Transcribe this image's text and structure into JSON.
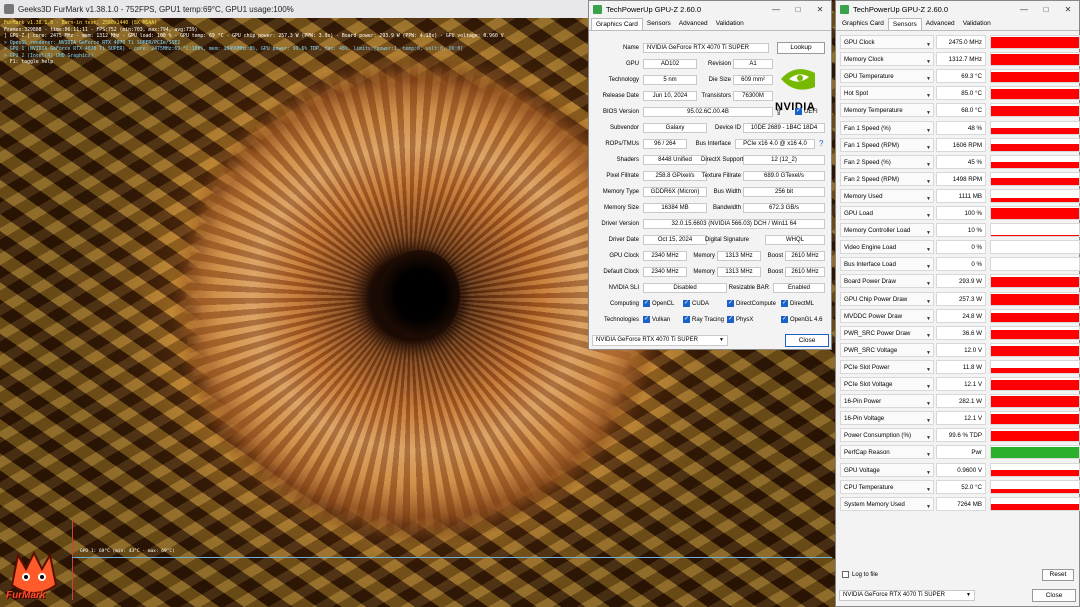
{
  "furmark": {
    "title": "Geeks3D FurMark v1.38.1.0 - 752FPS, GPU1 temp:69°C, GPU1 usage:100%",
    "hud": [
      {
        "t": "FurMark v1.38.1.0 - Burn-in test, 2560x1440 (8X MSAA)",
        "c": "y"
      },
      {
        "t": "Frames:329808 - time:06:11:11 - FPS:752 (min:703, max:794, avg:739)",
        "c": "w"
      },
      {
        "t": "[ GPU-Z ] core: 2475 MHz - mem: 1312 MHz - GPU load: 100 % - GPU temp: 69 °C - GPU chip power: 257.3 W (PPW: 3.9x) - Board power: 293.9 W (PPW: 4.18x) - GPU voltage: 0.960 V",
        "c": "w"
      },
      {
        "t": "> OpenGL renderer: NVIDIA GeForce RTX 4070 Ti SUPER/PCIe/SSE2",
        "c": "c"
      },
      {
        "t": "> GPU 1 (NVIDIA GeForce RTX 4070 Ti SUPER) - core: 2475MHz:69 °C:100%, mem: 10499MHz:8%, GPU power: 99.6% TDP, fan: 48%, limits:[power:1, temp:0, volt:0, OV:0]",
        "c": "c"
      },
      {
        "t": "> GPU 2 (Intel(R) UHD Graphics)",
        "c": "c"
      },
      {
        "t": "- F1: toggle help",
        "c": "w"
      }
    ],
    "graph_label": "GPU 1: 69°C (min: 43°C - max: 69°C)",
    "logo_text": "FurMark"
  },
  "gpuz_card": {
    "title": "TechPowerUp GPU-Z 2.60.0",
    "tabs": [
      "Graphics Card",
      "Sensors",
      "Advanced",
      "Validation"
    ],
    "active_tab": 0,
    "fields": {
      "name_label": "Name",
      "name": "NVIDIA GeForce RTX 4070 Ti SUPER",
      "lookup": "Lookup",
      "gpu_label": "GPU",
      "gpu": "AD102",
      "revision_label": "Revision",
      "revision": "A1",
      "tech_label": "Technology",
      "tech": "5 nm",
      "die_label": "Die Size",
      "die": "609 mm²",
      "release_label": "Release Date",
      "release": "Jun 10, 2024",
      "trans_label": "Transistors",
      "trans": "76300M",
      "bios_label": "BIOS Version",
      "bios": "95.02.6C.00.4B",
      "uefi": "UEFI",
      "subvendor_label": "Subvendor",
      "subvendor": "Galaxy",
      "devid_label": "Device ID",
      "devid": "10DE 2689 - 1B4C 18D4",
      "rops_label": "ROPs/TMUs",
      "rops": "96 / 264",
      "bus_label": "Bus Interface",
      "bus": "PCIe x16 4.0 @ x16 4.0",
      "help": "?",
      "shaders_label": "Shaders",
      "shaders": "8448 Unified",
      "dx_label": "DirectX Support",
      "dx": "12 (12_2)",
      "pix_label": "Pixel Fillrate",
      "pix": "258.8 GPixel/s",
      "tex_label": "Texture Fillrate",
      "tex": "689.0 GTexel/s",
      "memtype_label": "Memory Type",
      "memtype": "GDDR6X (Micron)",
      "bw_label": "Bus Width",
      "bw": "256 bit",
      "memsize_label": "Memory Size",
      "memsize": "16384 MB",
      "band_label": "Bandwidth",
      "band": "672.3 GB/s",
      "drv_label": "Driver Version",
      "drv": "32.0.15.6603 (NVIDIA 566.03) DCH / Win11 64",
      "drvdate_label": "Driver Date",
      "drvdate": "Oct 15, 2024",
      "sig_label": "Digital Signature",
      "sig": "WHQL",
      "gpuclk_label": "GPU Clock",
      "gpuclk": "2340 MHz",
      "mem_label": "Memory",
      "mem": "1313 MHz",
      "boost_label": "Boost",
      "boost": "2610 MHz",
      "defclk_label": "Default Clock",
      "defclk": "2340 MHz",
      "mem2": "1313 MHz",
      "boost2": "2610 MHz",
      "sli_label": "NVIDIA SLI",
      "sli": "Disabled",
      "rebar_label": "Resizable BAR",
      "rebar": "Enabled",
      "computing_label": "Computing",
      "technologies_label": "Technologies"
    },
    "computing": [
      "OpenCL",
      "CUDA",
      "DirectCompute",
      "DirectML"
    ],
    "technologies": [
      "Vulkan",
      "Ray Tracing",
      "PhysX",
      "OpenGL 4.6"
    ],
    "selected_gpu": "NVIDIA GeForce RTX 4070 Ti SUPER",
    "close": "Close",
    "nvidia": "NVIDIA"
  },
  "gpuz_sensors": {
    "title": "TechPowerUp GPU-Z 2.60.0",
    "tabs": [
      "Graphics Card",
      "Sensors",
      "Advanced",
      "Validation"
    ],
    "active_tab": 1,
    "rows": [
      {
        "name": "GPU Clock",
        "value": "2475.0 MHz",
        "level": 0.95
      },
      {
        "name": "Memory Clock",
        "value": "1312.7 MHz",
        "level": 0.95
      },
      {
        "name": "GPU Temperature",
        "value": "69.3 °C",
        "level": 0.85
      },
      {
        "name": "Hot Spot",
        "value": "85.0 °C",
        "level": 0.9
      },
      {
        "name": "Memory Temperature",
        "value": "68.0 °C",
        "level": 0.85
      },
      {
        "name": "Fan 1 Speed (%)",
        "value": "48 %",
        "level": 0.5
      },
      {
        "name": "Fan 1 Speed (RPM)",
        "value": "1606 RPM",
        "level": 0.55
      },
      {
        "name": "Fan 2 Speed (%)",
        "value": "45 %",
        "level": 0.5
      },
      {
        "name": "Fan 2 Speed (RPM)",
        "value": "1498 RPM",
        "level": 0.55
      },
      {
        "name": "Memory Used",
        "value": "1111 MB",
        "level": 0.35
      },
      {
        "name": "GPU Load",
        "value": "100 %",
        "level": 0.95
      },
      {
        "name": "Memory Controller Load",
        "value": "10 %",
        "level": 0.1
      },
      {
        "name": "Video Engine Load",
        "value": "0 %",
        "level": 0
      },
      {
        "name": "Bus Interface Load",
        "value": "0 %",
        "level": 0
      },
      {
        "name": "Board Power Draw",
        "value": "293.9 W",
        "level": 0.9
      },
      {
        "name": "GPU Chip Power Draw",
        "value": "257.3 W",
        "level": 0.85
      },
      {
        "name": "MVDDC Power Draw",
        "value": "24.8 W",
        "level": 0.7
      },
      {
        "name": "PWR_SRC Power Draw",
        "value": "36.6 W",
        "level": 0.7
      },
      {
        "name": "PWR_SRC Voltage",
        "value": "12.0 V",
        "level": 0.85
      },
      {
        "name": "PCIe Slot Power",
        "value": "11.8 W",
        "level": 0.4
      },
      {
        "name": "PCIe Slot Voltage",
        "value": "12.1 V",
        "level": 0.85
      },
      {
        "name": "16-Pin Power",
        "value": "282.1 W",
        "level": 0.9
      },
      {
        "name": "16-Pin Voltage",
        "value": "12.1 V",
        "level": 0.85
      },
      {
        "name": "Power Consumption (%)",
        "value": "99.6 % TDP",
        "level": 0.9
      },
      {
        "name": "PerfCap Reason",
        "value": "Pwr",
        "level": 0.95,
        "green": true
      },
      {
        "name": "GPU Voltage",
        "value": "0.9600 V",
        "level": 0.45
      },
      {
        "name": "CPU Temperature",
        "value": "52.0 °C",
        "level": 0.3
      },
      {
        "name": "System Memory Used",
        "value": "7264 MB",
        "level": 0.45
      }
    ],
    "log_label": "Log to file",
    "reset": "Reset",
    "selected_gpu": "NVIDIA GeForce RTX 4070 Ti SUPER",
    "close": "Close"
  }
}
